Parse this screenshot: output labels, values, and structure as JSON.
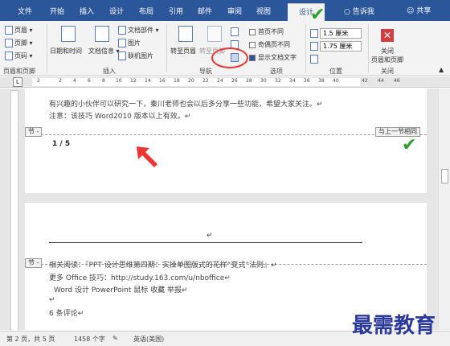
{
  "tabs": [
    "文件",
    "开始",
    "插入",
    "设计",
    "布局",
    "引用",
    "邮件",
    "审阅",
    "视图",
    "设计"
  ],
  "tell_me": "告诉我",
  "share": "共享",
  "ribbon": {
    "header_footer": {
      "header": "页眉",
      "footer": "页脚",
      "page_number": "页码",
      "group": "页眉和页脚"
    },
    "insert": {
      "datetime": "日期和时间",
      "doc_info": "文档信息",
      "doc_parts": "文档部件",
      "picture": "图片",
      "online_picture": "联机图片",
      "group": "插入"
    },
    "navigation": {
      "goto_header": "转至页眉",
      "goto_footer": "转至页脚",
      "group": "导航"
    },
    "options": {
      "diff_first": "首页不同",
      "diff_odd_even": "奇偶页不同",
      "show_doc_text": "显示文档文字",
      "group": "选项"
    },
    "position": {
      "top": "1.5 厘米",
      "bottom": "1.75 厘米",
      "group": "位置"
    },
    "close": {
      "label1": "关闭",
      "label2": "页眉和页脚",
      "group": "关闭"
    }
  },
  "ruler": {
    "corner": "L",
    "ticks": [
      "2",
      "2",
      "4",
      "6",
      "8",
      "10",
      "12",
      "14",
      "16",
      "18",
      "20",
      "22",
      "24",
      "26",
      "28",
      "30",
      "32",
      "34",
      "36",
      "38",
      "40",
      "42",
      "44",
      "46"
    ]
  },
  "page1": {
    "line1": "有兴趣的小伙伴可以研究一下，秦川老师也会以后多分享一些功能，希望大家关注。↵",
    "line2": "注意：该技巧 Word2010 版本以上有效。↵",
    "section_tag": "节 -",
    "page_num": "1 / 5",
    "link_prev": "与上一节相同"
  },
  "page2": {
    "section_tag": "节 -",
    "para_mark": "↵",
    "line1": "相关阅读：『PPT 设计思维第四期：实操单图版式的花样“变式”法则』↵",
    "line2": "更多 Office 技巧：http://study.163.com/u/nboffice↵",
    "line3": "Word  设计  PowerPoint  鼠标  收藏  举报↵",
    "line4": "↵",
    "line5": "6 条评论↵"
  },
  "status": {
    "page": "第 2 页，共 5 页",
    "words": "1458 个字",
    "lang": "英语(美国)"
  },
  "watermark": "最需教育"
}
